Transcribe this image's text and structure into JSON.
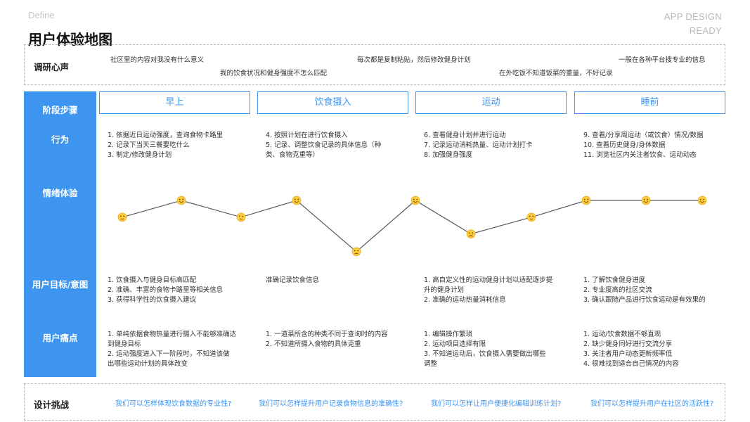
{
  "header": {
    "top_left": "Define",
    "top_right_1": "APP DESIGN",
    "top_right_2": "READY",
    "title": "用户体验地图"
  },
  "voice": {
    "label": "调研心声",
    "quotes": [
      "社区里的内容对我没有什么意义",
      "我的饮食状况和健身强度不怎么匹配",
      "每次都是复制粘贴，然后修改健身计划",
      "在外吃饭不知道饭菜的重量，不好记录",
      "一般在各种平台搜专业的信息"
    ]
  },
  "rows": {
    "stage": "阶段步骤",
    "behavior": "行为",
    "emotion": "情绪体验",
    "goal": "用户目标/意图",
    "pain": "用户痛点"
  },
  "stages": [
    "早上",
    "饮食摄入",
    "运动",
    "睡前"
  ],
  "behaviors": [
    [
      "1. 依据近日运动强度，查询食物卡路里",
      "2. 记录下当天三餐要吃什么",
      "3. 制定/修改健身计划"
    ],
    [
      "4. 按照计划在进行饮食摄入",
      "5. 记录、调整饮食记录的具体信息（种",
      "类、食物克重等）"
    ],
    [
      "6. 查看健身计划并进行运动",
      "7. 记录运动消耗热量、运动计划打卡",
      "8. 加强健身强度"
    ],
    [
      "9. 查看/分享周运动（或饮食）情况/数据",
      "10. 查看历史健身/身体数据",
      "11. 浏览社区内关注者饮食、运动动态"
    ]
  ],
  "goals": [
    [
      "1. 饮食摄入与健身目标高匹配",
      "2. 准确、丰富的食物卡路里等相关信息",
      "3. 获得科学性的饮食摄入建议"
    ],
    [
      "准确记录饮食信息"
    ],
    [
      "1. 高自定义性的运动健身计划以适配逐步提",
      "升的健身计划",
      "2. 准确的运动热量消耗信息"
    ],
    [
      "1. 了解饮食健身进度",
      "2. 专业度高的社区交流",
      "3. 确认跟随产品进行饮食运动是有效果的"
    ]
  ],
  "pains": [
    [
      "1. 单纯依据食物热量进行摄入不能够准确达",
      "到健身目标",
      "2. 运动强度进入下一阶段时，不知道该做",
      "出哪些运动计划的具体改变"
    ],
    [
      "1. 一道菜所含的种类不同于查询时的内容",
      "2. 不知道所摄入食物的具体克重"
    ],
    [
      "1. 编辑操作繁琐",
      "2. 运动项目选择有限",
      "3. 不知道运动后，饮食摄入需要做出哪些",
      "调整"
    ],
    [
      "1. 运动/饮食数据不够直观",
      "2. 缺少健身同好进行交流分享",
      "3. 关注者用户动态更新频率低",
      "4. 很难找到适合自己情况的内容"
    ]
  ],
  "challenge": {
    "label": "设计挑战",
    "items": [
      "我们可以怎样体现饮食数据的专业性?",
      "我们可以怎样提升用户记录食物信息的准确性?",
      "我们可以怎样让用户便捷化编辑训练计划?",
      "我们可以怎样提升用户在社区的活跃性?"
    ]
  },
  "emotion_line": {
    "color": "#5a5a5a",
    "points": [
      {
        "mood": "neutral",
        "level": 0.58
      },
      {
        "mood": "happy",
        "level": 0.75
      },
      {
        "mood": "neutral",
        "level": 0.58
      },
      {
        "mood": "happy",
        "level": 0.75
      },
      {
        "mood": "sad",
        "level": 0.23
      },
      {
        "mood": "happy",
        "level": 0.75
      },
      {
        "mood": "sad",
        "level": 0.41
      },
      {
        "mood": "neutral",
        "level": 0.58
      },
      {
        "mood": "happy",
        "level": 0.75
      },
      {
        "mood": "happy",
        "level": 0.75
      },
      {
        "mood": "happy",
        "level": 0.75
      }
    ]
  }
}
